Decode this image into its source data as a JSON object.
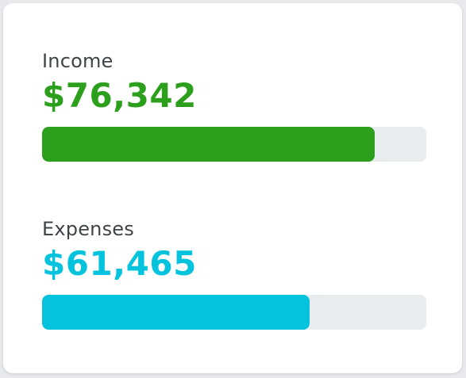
{
  "metrics": {
    "income": {
      "label": "Income",
      "amount": "$76,342",
      "progress": 0.865,
      "color": "#2ca01c"
    },
    "expenses": {
      "label": "Expenses",
      "amount": "$61,465",
      "progress": 0.697,
      "color": "#05c3dc"
    }
  },
  "colors": {
    "track": "#e8ecef",
    "label_text": "#3f4448",
    "card_background": "#ffffff"
  }
}
